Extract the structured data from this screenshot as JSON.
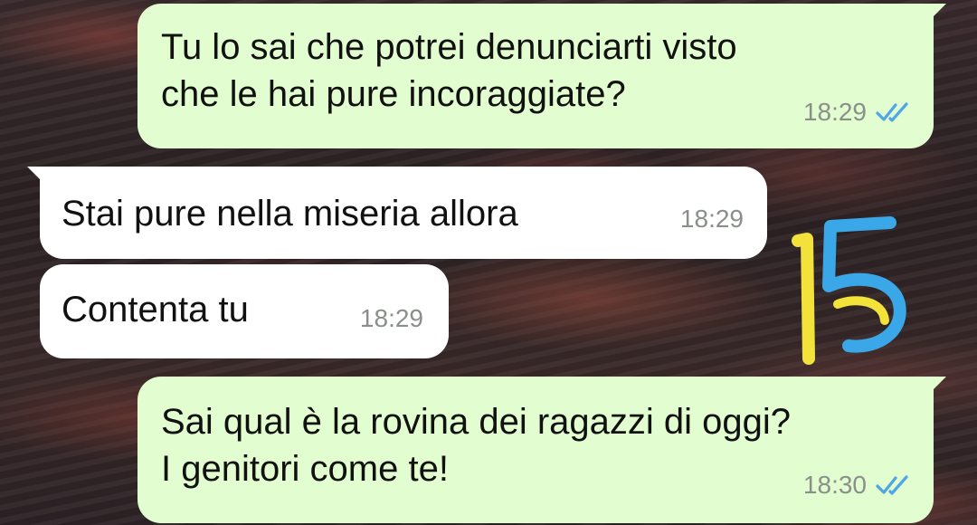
{
  "messages": [
    {
      "direction": "outgoing",
      "text": "Tu lo sai che potrei denunciarti visto\nche le hai pure incoraggiate?",
      "time": "18:29",
      "status_icon": "double-check-read-icon"
    },
    {
      "direction": "incoming",
      "text": "Stai pure nella miseria allora",
      "time": "18:29"
    },
    {
      "direction": "incoming",
      "text": "Contenta tu",
      "time": "18:29"
    },
    {
      "direction": "outgoing",
      "text": "Sai qual è la rovina dei ragazzi di oggi?\nI genitori come te!",
      "time": "18:30",
      "status_icon": "double-check-read-icon"
    }
  ],
  "overlay": {
    "handwritten_number": "15",
    "colors": {
      "digit_1": "#f2e23a",
      "digit_5": "#3aa8e8"
    }
  },
  "colors": {
    "outgoing_bubble": "#e2fdcf",
    "incoming_bubble": "#ffffff",
    "timestamp": "#8a8f8a",
    "read_ticks": "#4fa6e6"
  }
}
